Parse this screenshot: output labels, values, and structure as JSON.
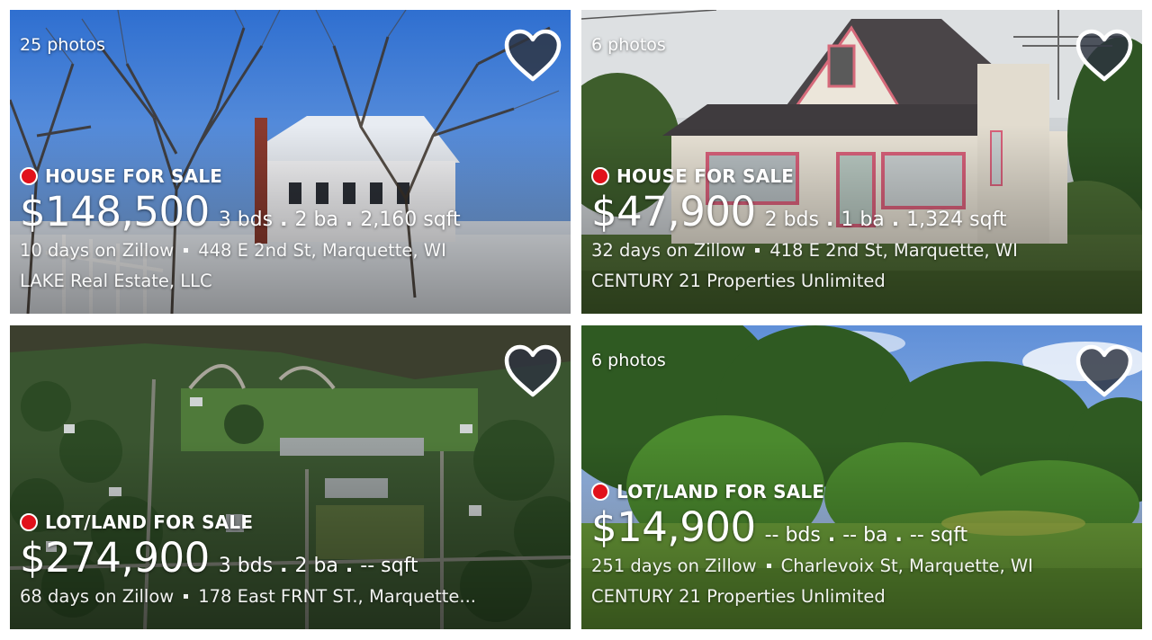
{
  "listings": [
    {
      "photos": "25 photos",
      "status": "HOUSE FOR SALE",
      "price": "$148,500",
      "beds": "3 bds",
      "baths": "2 ba",
      "sqft": "2,160 sqft",
      "days": "10 days on Zillow",
      "address": "448 E 2nd St, Marquette, WI",
      "broker": "LAKE Real Estate, LLC",
      "icon": "heart-icon"
    },
    {
      "photos": "6 photos",
      "status": "HOUSE FOR SALE",
      "price": "$47,900",
      "beds": "2 bds",
      "baths": "1 ba",
      "sqft": "1,324 sqft",
      "days": "32 days on Zillow",
      "address": "418 E 2nd St, Marquette, WI",
      "broker": "CENTURY 21 Properties Unlimited",
      "icon": "heart-icon"
    },
    {
      "photos": "",
      "status": "LOT/LAND FOR SALE",
      "price": "$274,900",
      "beds": "3 bds",
      "baths": "2 ba",
      "sqft": "-- sqft",
      "days": "68 days on Zillow",
      "address": "178 East FRNT ST., Marquette...",
      "broker": "",
      "icon": "heart-icon"
    },
    {
      "photos": "6 photos",
      "status": "LOT/LAND FOR SALE",
      "price": "$14,900",
      "beds": "-- bds",
      "baths": "-- ba",
      "sqft": "-- sqft",
      "days": "251 days on Zillow",
      "address": "Charlevoix St, Marquette, WI",
      "broker": "CENTURY 21 Properties Unlimited",
      "icon": "heart-icon"
    }
  ],
  "colors": {
    "status_dot": "#e1111b",
    "text": "#ffffff",
    "heart_fill": "#2d3340"
  }
}
